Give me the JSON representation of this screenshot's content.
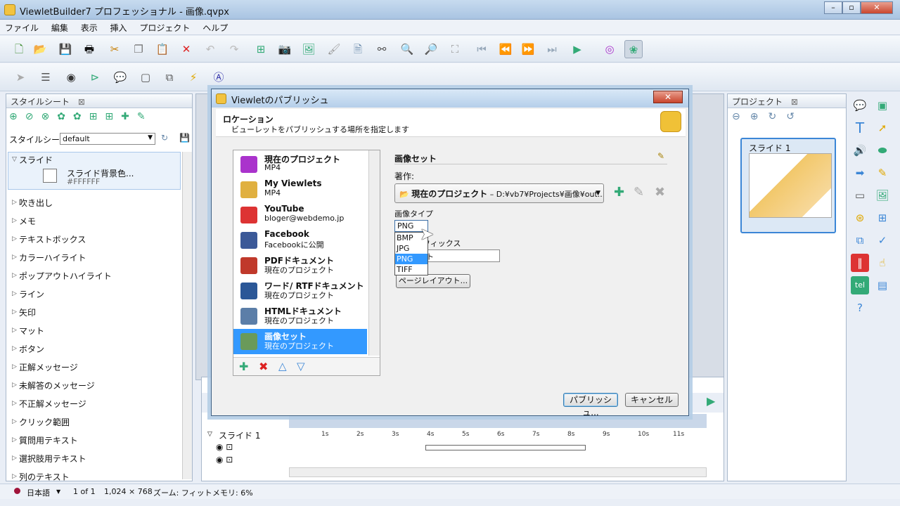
{
  "window": {
    "title": "ViewletBuilder7 プロフェッショナル - 画像.qvpx"
  },
  "menu": [
    "ファイル",
    "編集",
    "表示",
    "挿入",
    "プロジェクト",
    "ヘルプ"
  ],
  "stylesheet_panel": {
    "title": "スタイルシート",
    "label": "スタイルシート:",
    "value": "default",
    "slide_group": "スライド",
    "slide_bg_label": "スライド背景色...",
    "slide_bg_value": "#FFFFFF",
    "items": [
      "吹き出し",
      "メモ",
      "テキストボックス",
      "カラーハイライト",
      "ポップアウトハイライト",
      "ライン",
      "矢印",
      "マット",
      "ボタン",
      "正解メッセージ",
      "未解答のメッセージ",
      "不正解メッセージ",
      "クリック範囲",
      "質問用テキスト",
      "選択肢用テキスト",
      "列のテキスト"
    ]
  },
  "project_panel": {
    "title": "プロジェクト",
    "slide_label": "スライド 1"
  },
  "timeline": {
    "slide_label": "スライド 1",
    "ticks": [
      "1s",
      "2s",
      "3s",
      "4s",
      "5s",
      "6s",
      "7s",
      "8s",
      "9s",
      "10s",
      "11s"
    ]
  },
  "status": {
    "language": "日本語",
    "page": "1 of 1",
    "resolution": "1,024 × 768",
    "zoom": "ズーム: フィット",
    "memory": "メモリ: 6%"
  },
  "dialog": {
    "title": "Viewletのパブリッシュ",
    "heading": "ロケーション",
    "subheading": "ビューレットをパブリッシュする場所を指定します",
    "targets": [
      {
        "name": "現在のプロジェクト",
        "sub": "MP4"
      },
      {
        "name": "My Viewlets",
        "sub": "MP4"
      },
      {
        "name": "YouTube",
        "sub": "bloger@webdemo.jp"
      },
      {
        "name": "Facebook",
        "sub": "Facebookに公開"
      },
      {
        "name": "PDFドキュメント",
        "sub": "現在のプロジェクト"
      },
      {
        "name": "ワード/ RTFドキュメント",
        "sub": "現在のプロジェクト"
      },
      {
        "name": "HTMLドキュメント",
        "sub": "現在のプロジェクト"
      },
      {
        "name": "画像セット",
        "sub": "現在のプロジェクト"
      }
    ],
    "section_title": "画像セット",
    "location_label": "著作:",
    "location_name": "現在のプロジェクト",
    "location_sep": " – ",
    "location_path": "D:¥vb7¥Projects¥画像¥out...",
    "image_type_label": "画像タイプ",
    "image_type_value": "PNG",
    "image_type_options": [
      "BMP",
      "JPG",
      "PNG",
      "TIFF"
    ],
    "prefix_label": "フィックス",
    "prefix_value": "ト",
    "page_layout_button": "ページレイアウト...",
    "publish_button": "パブリッシュ...",
    "cancel_button": "キャンセル"
  }
}
